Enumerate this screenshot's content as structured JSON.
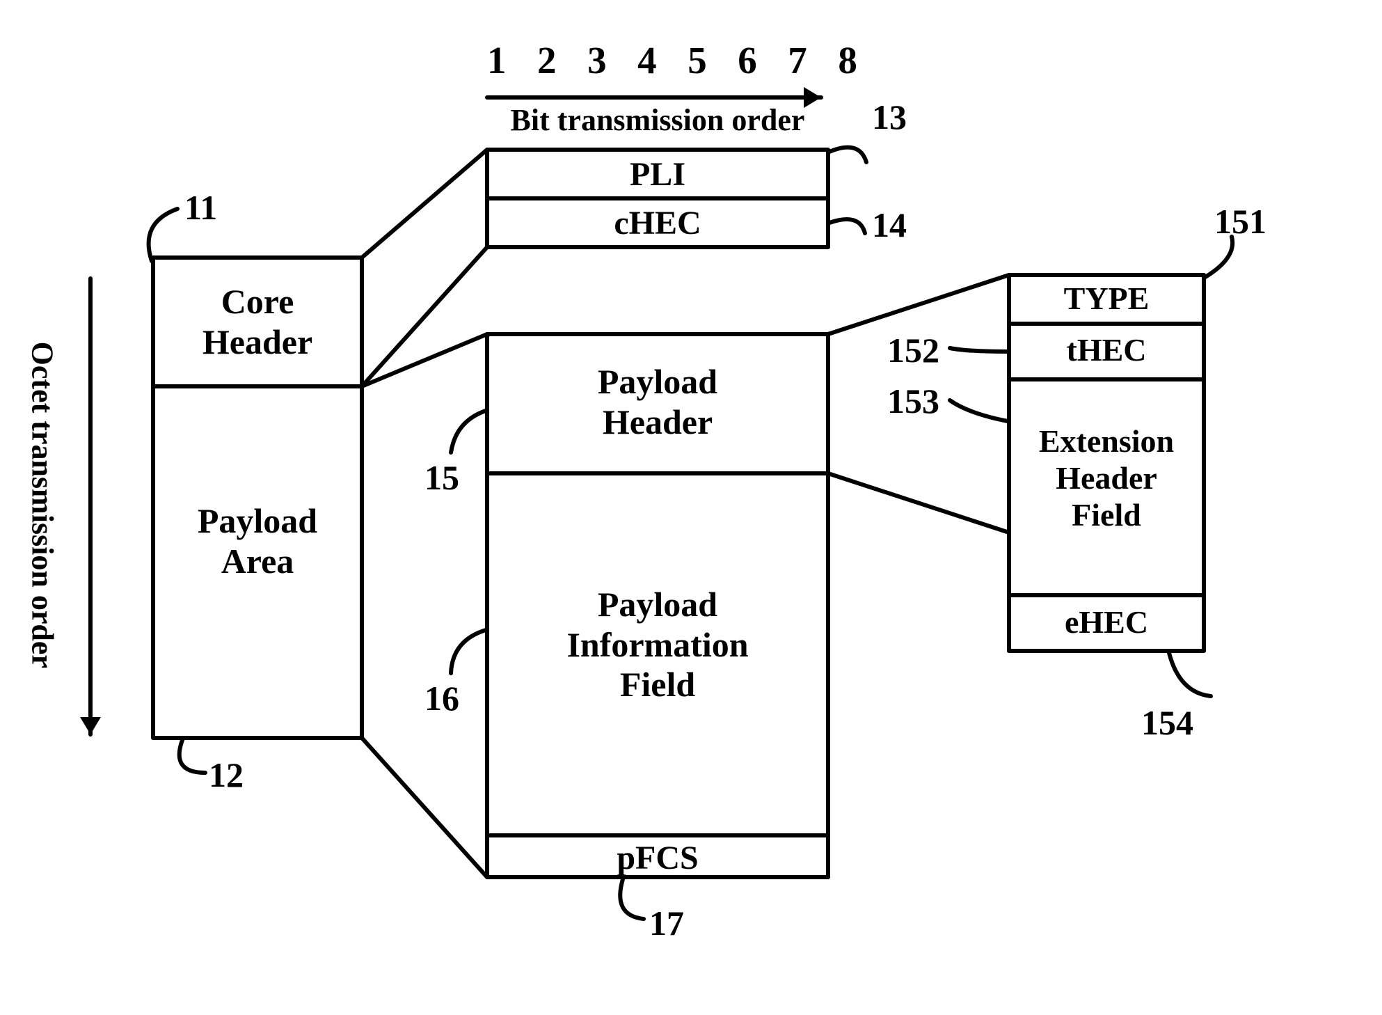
{
  "bit_numbers": "1 2 3 4 5 6 7 8",
  "bit_caption": "Bit transmission order",
  "octet_caption": "Octet transmission order",
  "col1": {
    "core_header": "Core\nHeader",
    "payload_area": "Payload\nArea"
  },
  "col2_top": {
    "pli": "PLI",
    "chec": "cHEC"
  },
  "col2": {
    "payload_header": "Payload\nHeader",
    "payload_info": "Payload\nInformation\nField",
    "pfcs": "pFCS"
  },
  "col3": {
    "type": "TYPE",
    "thec": "tHEC",
    "ext_header": "Extension\nHeader\nField",
    "ehec": "eHEC"
  },
  "refs": {
    "r11": "11",
    "r12": "12",
    "r13": "13",
    "r14": "14",
    "r15": "15",
    "r16": "16",
    "r17": "17",
    "r151": "151",
    "r152": "152",
    "r153": "153",
    "r154": "154"
  }
}
